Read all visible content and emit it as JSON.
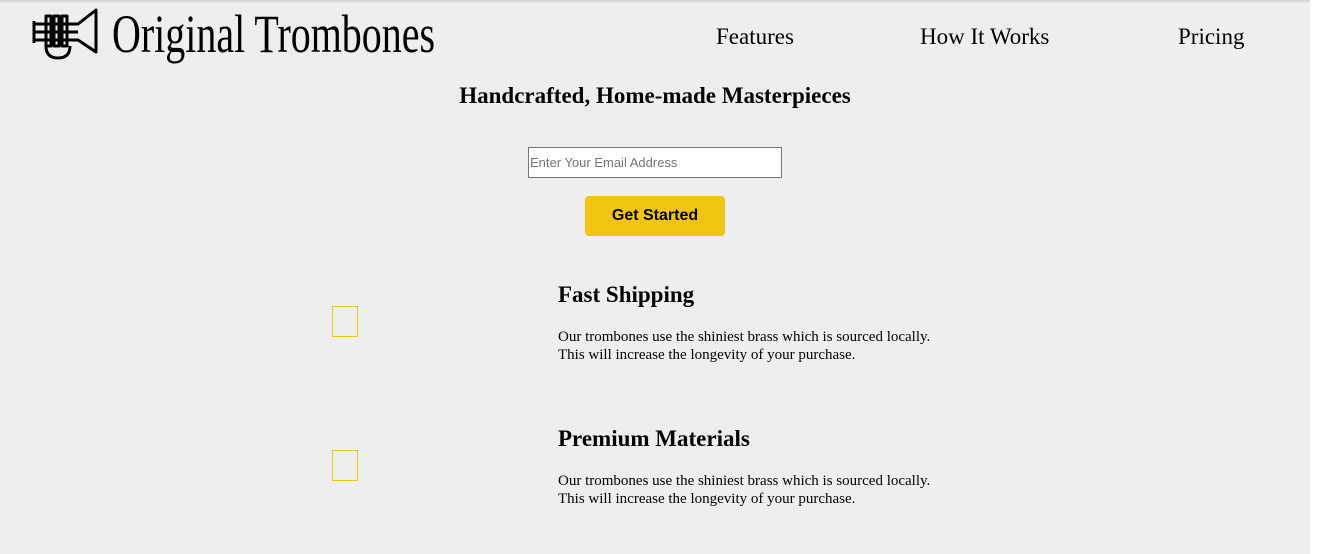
{
  "header": {
    "brand": "Original Trombones",
    "logo_icon": "trumpet-icon",
    "nav": [
      {
        "label": "Features"
      },
      {
        "label": "How It Works"
      },
      {
        "label": "Pricing"
      }
    ]
  },
  "hero": {
    "title": "Handcrafted, Home-made Masterpieces",
    "email_placeholder": "Enter Your Email Address",
    "email_value": "",
    "cta_label": "Get Started"
  },
  "features": [
    {
      "icon": "placeholder-icon",
      "title": "Fast Shipping",
      "description_lines": [
        "Our trombones use the shiniest brass which is sourced locally.",
        "This will increase the longevity of your purchase."
      ]
    },
    {
      "icon": "placeholder-icon",
      "title": "Premium Materials",
      "description_lines": [
        "Our trombones use the shiniest brass which is sourced locally.",
        "This will increase the longevity of your purchase."
      ]
    }
  ],
  "colors": {
    "background": "#eeeeee",
    "accent": "#f1c40f",
    "text": "#000000"
  }
}
